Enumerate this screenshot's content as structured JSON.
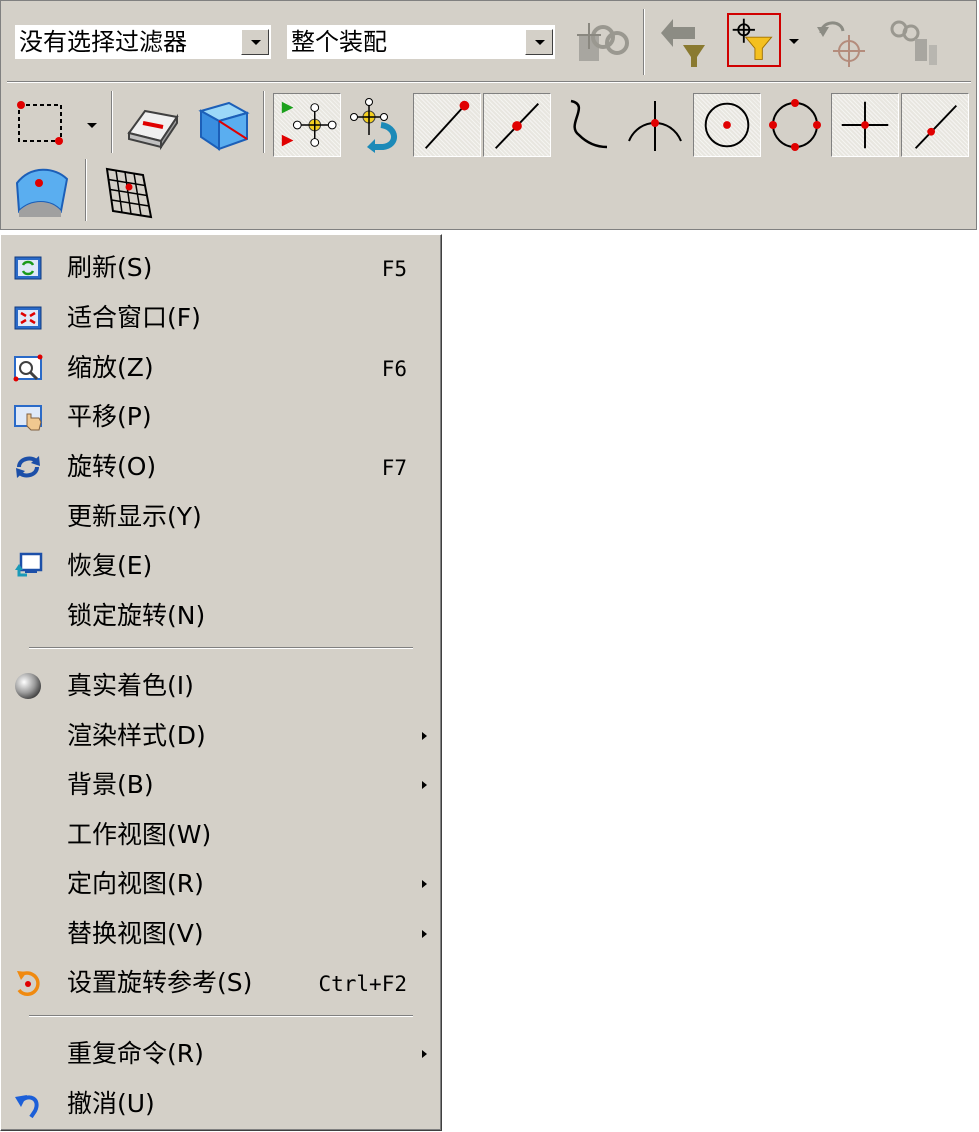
{
  "toolbar": {
    "filter_combo": {
      "value": "没有选择过滤器"
    },
    "scope_combo": {
      "value": "整个装配"
    },
    "icons_row1": [
      "assembly-constraint-icon",
      "undo-filter-icon",
      "snap-filter-icon",
      "undo-snap-icon",
      "disabled-constraint-icon"
    ],
    "icons_row2": [
      "rectangle-select-icon",
      "eraser-icon",
      "cube-icon",
      "snap-point-icon",
      "snap-point-return-icon",
      "endpoint-icon",
      "midpoint-icon",
      "curve-point-icon",
      "intersection-icon",
      "arc-center-icon",
      "quadrant-icon",
      "perpendicular-icon",
      "tangent-point-icon"
    ],
    "icons_row3": [
      "surface-point-icon",
      "grid-icon"
    ]
  },
  "menu": {
    "items": [
      {
        "label": "刷新(S)",
        "shortcut": "F5",
        "icon": "refresh-icon"
      },
      {
        "label": "适合窗口(F)",
        "shortcut": "",
        "icon": "fit-window-icon"
      },
      {
        "label": "缩放(Z)",
        "shortcut": "F6",
        "icon": "zoom-icon"
      },
      {
        "label": "平移(P)",
        "shortcut": "",
        "icon": "pan-icon"
      },
      {
        "label": "旋转(O)",
        "shortcut": "F7",
        "icon": "rotate-icon"
      },
      {
        "label": "更新显示(Y)",
        "shortcut": "",
        "icon": ""
      },
      {
        "label": "恢复(E)",
        "shortcut": "",
        "icon": "restore-icon"
      },
      {
        "label": "锁定旋转(N)",
        "shortcut": "",
        "icon": ""
      },
      {
        "label": "真实着色(I)",
        "shortcut": "",
        "icon": "true-shading-icon"
      },
      {
        "label": "渲染样式(D)",
        "shortcut": "",
        "icon": "",
        "submenu": true
      },
      {
        "label": "背景(B)",
        "shortcut": "",
        "icon": "",
        "submenu": true
      },
      {
        "label": "工作视图(W)",
        "shortcut": "",
        "icon": ""
      },
      {
        "label": "定向视图(R)",
        "shortcut": "",
        "icon": "",
        "submenu": true
      },
      {
        "label": "替换视图(V)",
        "shortcut": "",
        "icon": "",
        "submenu": true
      },
      {
        "label": "设置旋转参考(S)",
        "shortcut": "Ctrl+F2",
        "icon": "set-rotation-reference-icon"
      },
      {
        "label": "重复命令(R)",
        "shortcut": "",
        "icon": "",
        "submenu": true
      },
      {
        "label": "撤消(U)",
        "shortcut": "",
        "icon": "undo-icon"
      }
    ]
  },
  "colors": {
    "face": "#d4d0c8",
    "accent_red": "#e00000",
    "icon_blue": "#1c5fb8"
  }
}
